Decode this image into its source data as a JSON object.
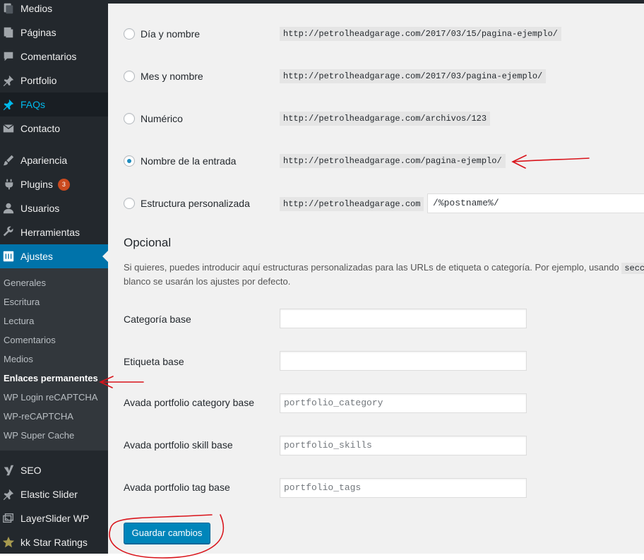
{
  "sidebar": {
    "menu": [
      {
        "label": "Medios",
        "icon": "media-icon"
      },
      {
        "label": "Páginas",
        "icon": "pages-icon"
      },
      {
        "label": "Comentarios",
        "icon": "comments-icon"
      },
      {
        "label": "Portfolio",
        "icon": "pin-icon"
      },
      {
        "label": "FAQs",
        "icon": "pin-icon"
      },
      {
        "label": "Contacto",
        "icon": "mail-icon"
      },
      {
        "label": "Apariencia",
        "icon": "paintbrush-icon"
      },
      {
        "label": "Plugins",
        "icon": "plugin-icon",
        "badge": "3"
      },
      {
        "label": "Usuarios",
        "icon": "users-icon"
      },
      {
        "label": "Herramientas",
        "icon": "wrench-icon"
      },
      {
        "label": "Ajustes",
        "icon": "settings-icon"
      }
    ],
    "submenu": [
      "Generales",
      "Escritura",
      "Lectura",
      "Comentarios",
      "Medios",
      "Enlaces permanentes",
      "WP Login reCAPTCHA",
      "WP-reCAPTCHA",
      "WP Super Cache"
    ],
    "menu_bottom": [
      {
        "label": "SEO",
        "icon": "yoast-icon"
      },
      {
        "label": "Elastic Slider",
        "icon": "pin-icon"
      },
      {
        "label": "LayerSlider WP",
        "icon": "layers-icon"
      },
      {
        "label": "kk Star Ratings",
        "icon": "star-icon"
      }
    ]
  },
  "permalinks": {
    "options": [
      {
        "label": "Día y nombre",
        "example": "http://petrolheadgarage.com/2017/03/15/pagina-ejemplo/",
        "checked": false
      },
      {
        "label": "Mes y nombre",
        "example": "http://petrolheadgarage.com/2017/03/pagina-ejemplo/",
        "checked": false
      },
      {
        "label": "Numérico",
        "example": "http://petrolheadgarage.com/archivos/123",
        "checked": false
      },
      {
        "label": "Nombre de la entrada",
        "example": "http://petrolheadgarage.com/pagina-ejemplo/",
        "checked": true
      },
      {
        "label": "Estructura personalizada",
        "example": "http://petrolheadgarage.com",
        "checked": false
      }
    ],
    "custom_value": "/%postname%/"
  },
  "optional": {
    "heading": "Opcional",
    "desc_line1": "Si quieres, puedes introducir aquí estructuras personalizadas para las URLs de etiqueta o categoría. Por ejemplo, usando ",
    "desc_code": "seccio",
    "desc_line2": "blanco se usarán los ajustes por defecto.",
    "fields": [
      {
        "label": "Categoría base",
        "value": ""
      },
      {
        "label": "Etiqueta base",
        "value": ""
      },
      {
        "label": "Avada portfolio category base",
        "value": "portfolio_category"
      },
      {
        "label": "Avada portfolio skill base",
        "value": "portfolio_skills"
      },
      {
        "label": "Avada portfolio tag base",
        "value": "portfolio_tags"
      }
    ]
  },
  "save_label": "Guardar cambios",
  "colors": {
    "accent": "#0073aa",
    "annotation": "#d9141b",
    "sidebar": "#23282d"
  }
}
